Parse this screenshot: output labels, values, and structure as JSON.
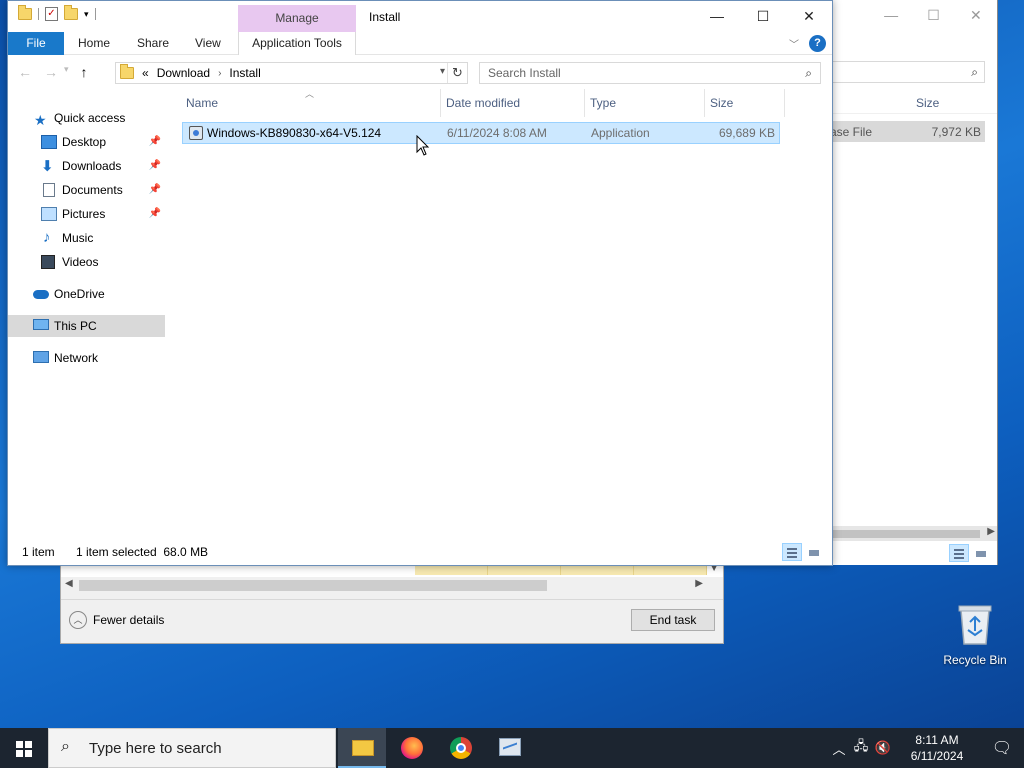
{
  "explorer": {
    "title": "Install",
    "manage_tab": "Manage",
    "ribbon_tabs": {
      "file": "File",
      "home": "Home",
      "share": "Share",
      "view": "View",
      "app_tools": "Application Tools"
    },
    "address": {
      "overflow": "«",
      "crumbs": [
        "Download",
        "Install"
      ]
    },
    "search_placeholder": "Search Install",
    "nav": {
      "quick_access": "Quick access",
      "desktop": "Desktop",
      "downloads": "Downloads",
      "documents": "Documents",
      "pictures": "Pictures",
      "music": "Music",
      "videos": "Videos",
      "onedrive": "OneDrive",
      "this_pc": "This PC",
      "network": "Network"
    },
    "columns": {
      "name": "Name",
      "date": "Date modified",
      "type": "Type",
      "size": "Size"
    },
    "files": [
      {
        "name": "Windows-KB890830-x64-V5.124",
        "date": "6/11/2024 8:08 AM",
        "type": "Application",
        "size": "69,689 KB",
        "selected": true
      }
    ],
    "status": {
      "count": "1 item",
      "selection": "1 item selected  68.0 MB"
    }
  },
  "bg_explorer": {
    "size_header": "Size",
    "row_type": "ase File",
    "row_size": "7,972 KB"
  },
  "task_manager": {
    "fewer_details": "Fewer details",
    "end_task": "End task"
  },
  "desktop": {
    "recycle_bin": "Recycle Bin"
  },
  "taskbar": {
    "search_placeholder": "Type here to search",
    "time": "8:11 AM",
    "date": "6/11/2024"
  },
  "colors": {
    "accent": "#1979ca",
    "selection": "#cce8ff",
    "manage_tab": "#e8c8f0",
    "taskbar": "#1c2530"
  }
}
